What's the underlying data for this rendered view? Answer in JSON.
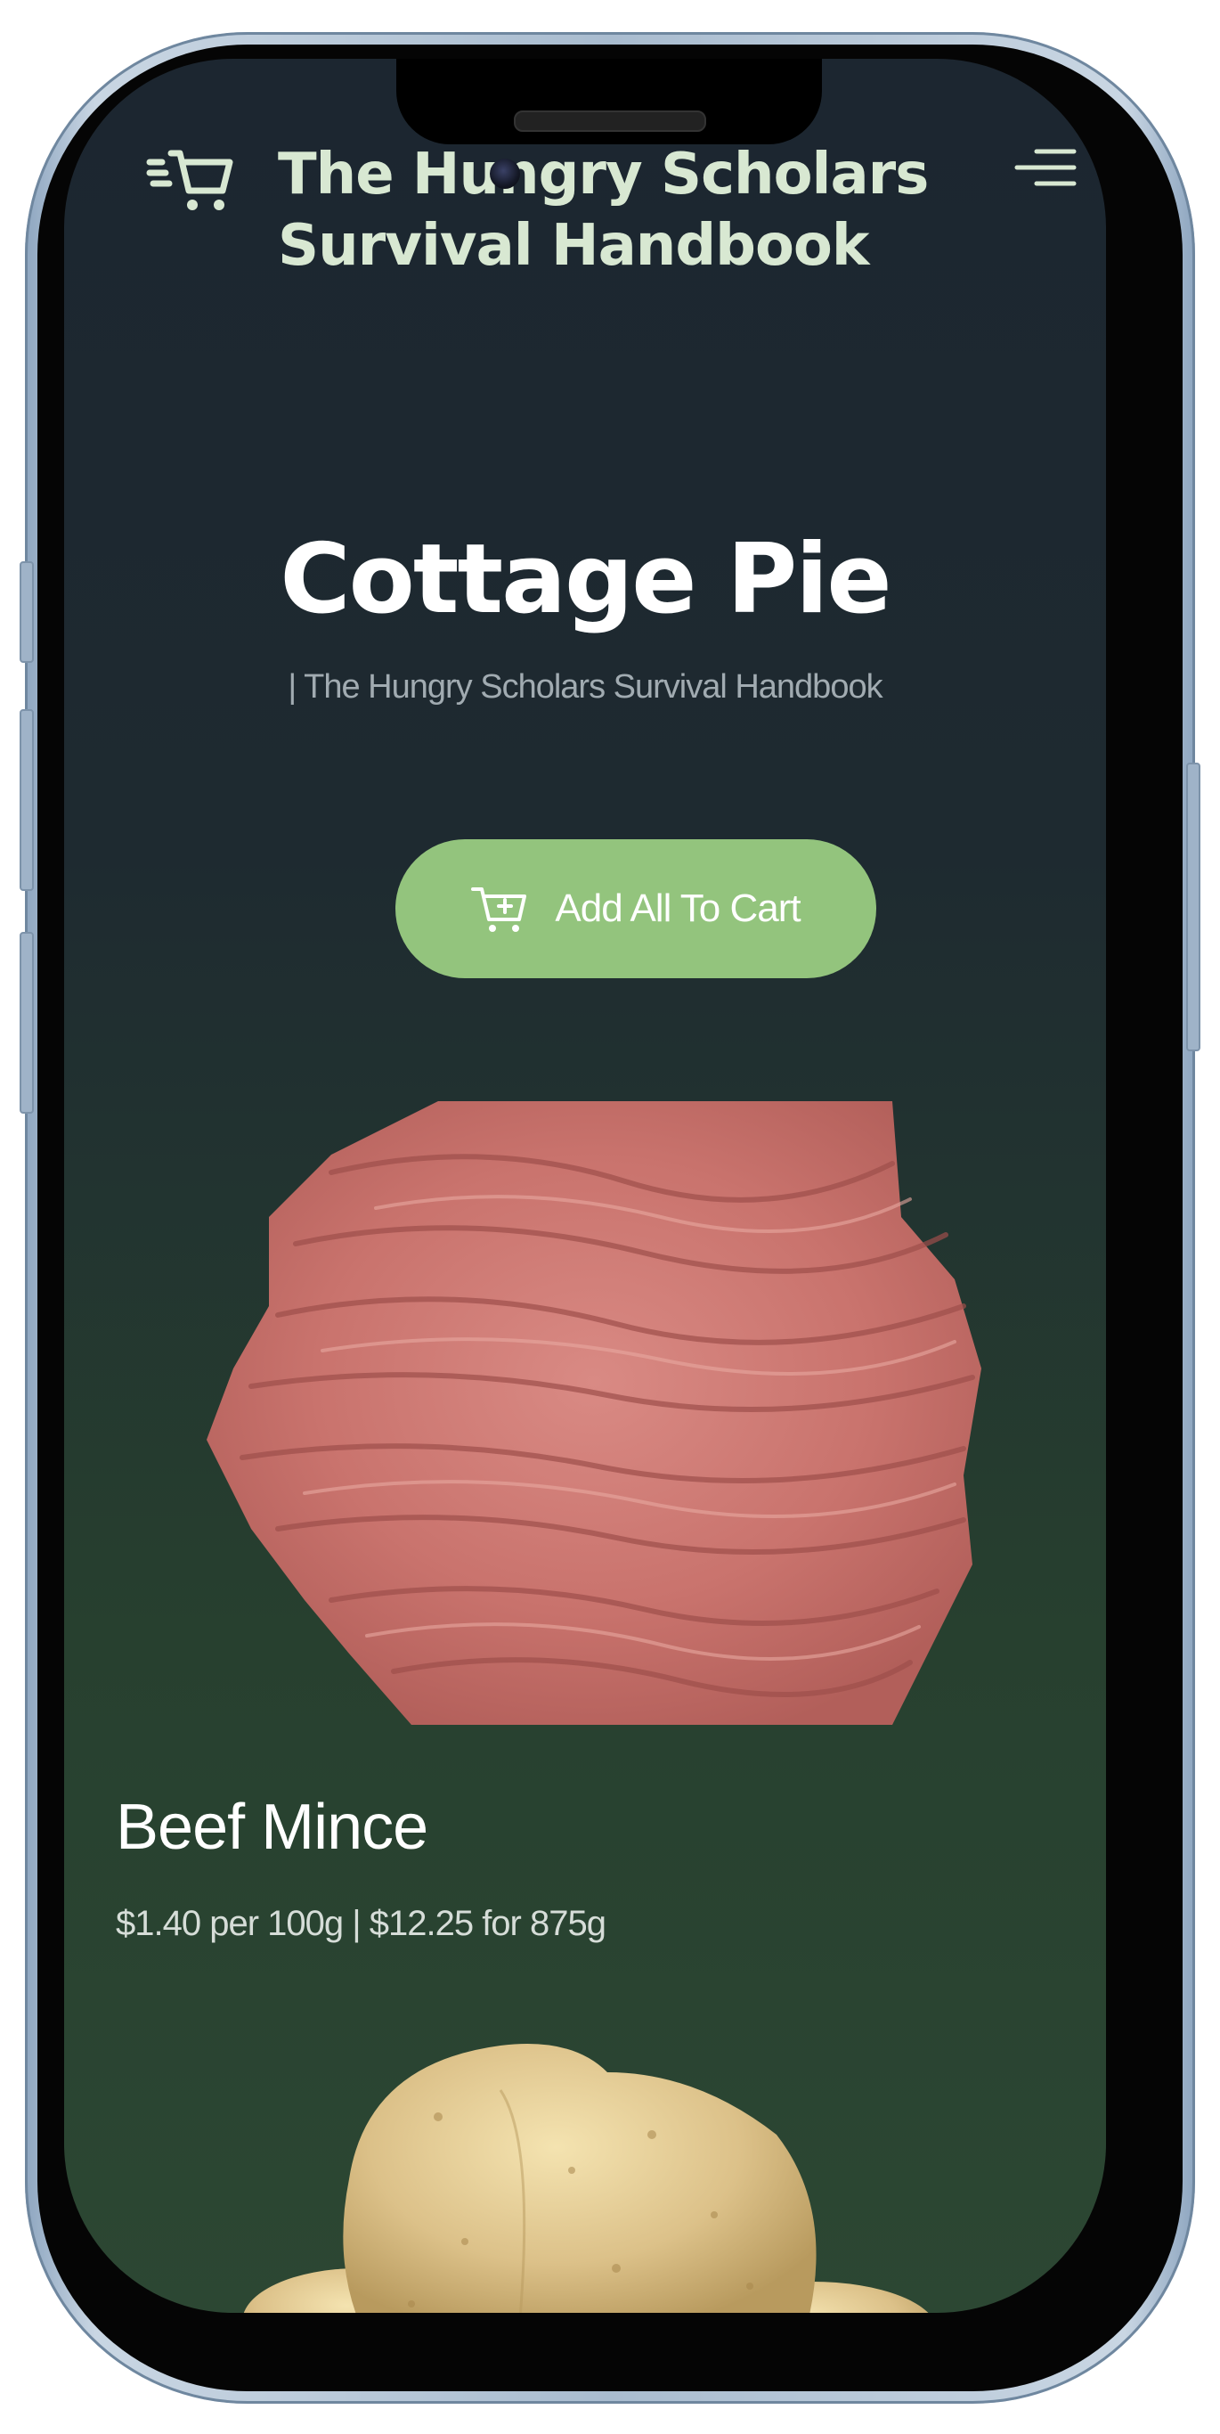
{
  "header": {
    "site_title": "The Hungry Scholars Survival Handbook",
    "cart_icon": "cart-icon",
    "menu_icon": "menu-icon"
  },
  "recipe": {
    "title": "Cottage Pie",
    "subtitle": "| The Hungry Scholars Survival Handbook",
    "add_all_label": "Add All To Cart",
    "add_all_icon": "add-to-cart-icon"
  },
  "products": [
    {
      "name": "Beef Mince",
      "price": "$1.40 per 100g | $12.25 for 875g",
      "image": "beef-mince-image"
    },
    {
      "image": "potato-image"
    }
  ],
  "colors": {
    "accent": "#93c47d",
    "title_text": "#d8e8d2",
    "background_top": "#1c2630",
    "background_bottom": "#2c4733"
  }
}
